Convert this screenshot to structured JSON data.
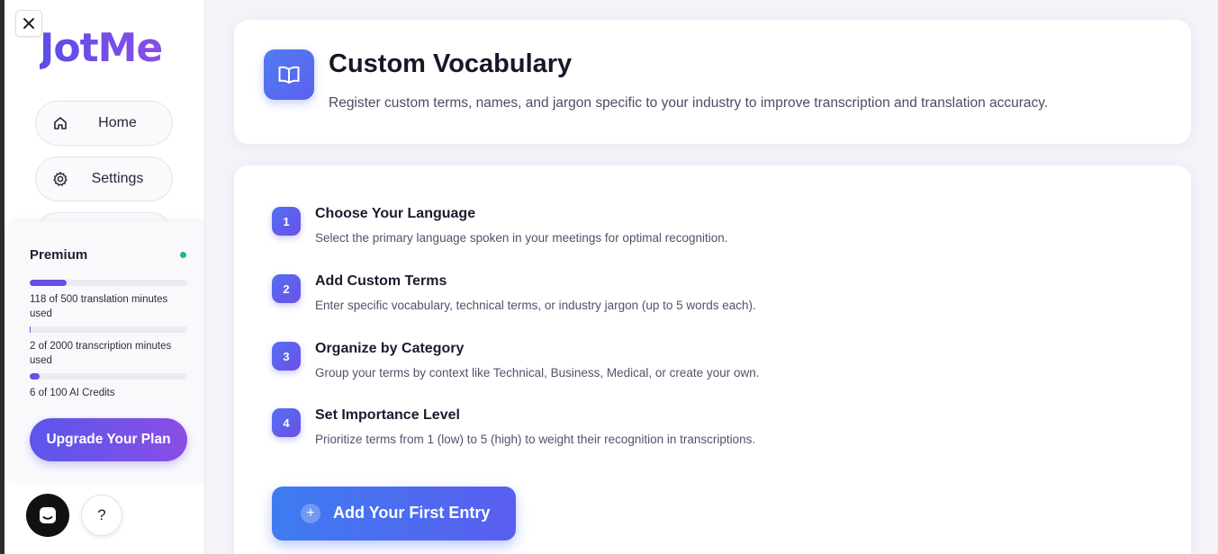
{
  "sidebar": {
    "logo": "JotMe",
    "nav": [
      {
        "label": "Home",
        "icon": "home-icon"
      },
      {
        "label": "Settings",
        "icon": "gear-icon"
      }
    ],
    "usage": {
      "plan": "Premium",
      "status_color": "#22b48a",
      "translation_progress": 0.236,
      "translation_text": "118 of 500 translation minutes used",
      "transcription_progress": 0.001,
      "transcription_text": "2 of 2000 transcription minutes used",
      "credits_progress": 0.06,
      "credits_text": "6 of 100 AI Credits",
      "upgrade_label": "Upgrade Your Plan"
    },
    "help_label": "?"
  },
  "header": {
    "icon": "book-icon",
    "title": "Custom Vocabulary",
    "subtitle": "Register custom terms, names, and jargon specific to your industry to improve transcription and translation accuracy."
  },
  "steps": [
    {
      "number": "1",
      "title": "Choose Your Language",
      "description": "Select the primary language spoken in your meetings for optimal recognition."
    },
    {
      "number": "2",
      "title": "Add Custom Terms",
      "description": "Enter specific vocabulary, technical terms, or industry jargon (up to 5 words each)."
    },
    {
      "number": "3",
      "title": "Organize by Category",
      "description": "Group your terms by context like Technical, Business, Medical, or create your own."
    },
    {
      "number": "4",
      "title": "Set Importance Level",
      "description": "Prioritize terms from 1 (low) to 5 (high) to weight their recognition in transcriptions."
    }
  ],
  "add_entry_label": "Add Your First Entry",
  "colors": {
    "brand": "#6a4ee6",
    "accent_blue": "#4f7df0"
  }
}
